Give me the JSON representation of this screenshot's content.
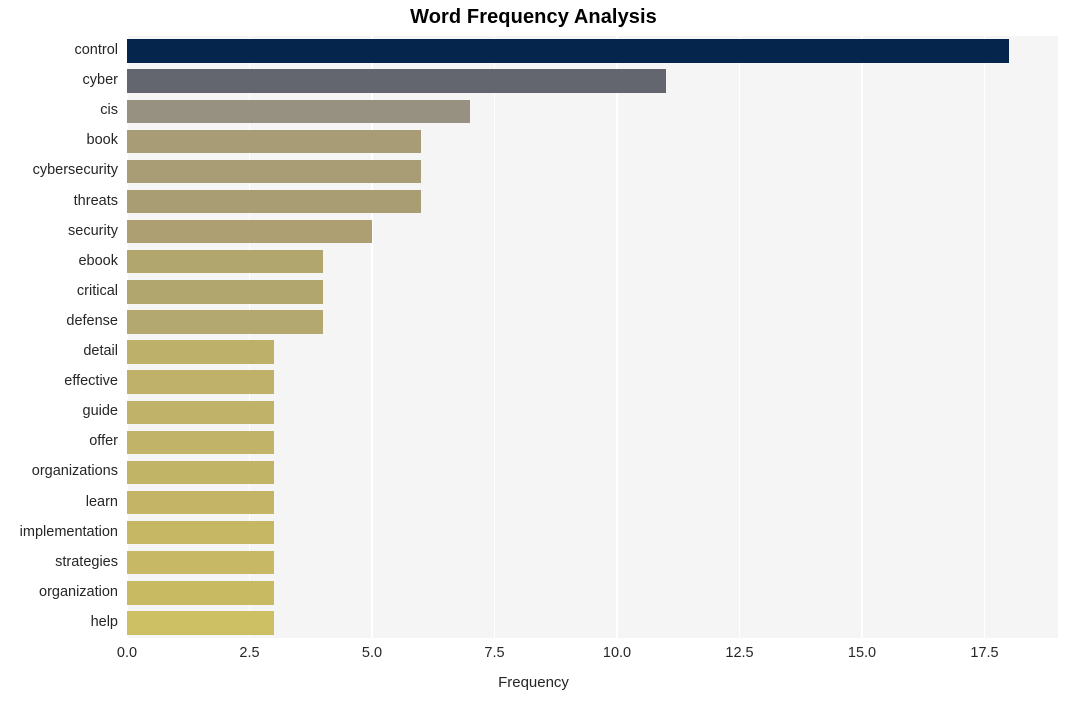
{
  "chart_data": {
    "type": "bar",
    "orientation": "horizontal",
    "title": "Word Frequency Analysis",
    "xlabel": "Frequency",
    "ylabel": "",
    "categories": [
      "control",
      "cyber",
      "cis",
      "book",
      "cybersecurity",
      "threats",
      "security",
      "ebook",
      "critical",
      "defense",
      "detail",
      "effective",
      "guide",
      "offer",
      "organizations",
      "learn",
      "implementation",
      "strategies",
      "organization",
      "help"
    ],
    "values": [
      18,
      11,
      7,
      6,
      6,
      6,
      5,
      4,
      4,
      4,
      3,
      3,
      3,
      3,
      3,
      3,
      3,
      3,
      3,
      3
    ],
    "bar_colors": [
      "#06254d",
      "#63666f",
      "#969180",
      "#a79c76",
      "#a89d74",
      "#a99e73",
      "#ad9f71",
      "#b2a66f",
      "#b2a66f",
      "#b3a870",
      "#bdb06a",
      "#bfb169",
      "#c0b268",
      "#c1b367",
      "#c2b466",
      "#c3b565",
      "#c5b764",
      "#c6b864",
      "#c8ba63",
      "#cdbf63"
    ],
    "xticks": [
      "0.0",
      "2.5",
      "5.0",
      "7.5",
      "10.0",
      "12.5",
      "15.0",
      "17.5"
    ],
    "xtick_values": [
      0,
      2.5,
      5,
      7.5,
      10,
      12.5,
      15,
      17.5
    ],
    "xlim": [
      0,
      19
    ],
    "grid": true,
    "grid_axis": "x",
    "legend": "none",
    "plot_background": "#f5f5f6",
    "grid_color": "#ffffff",
    "figure_background": "#ffffff",
    "text_color": "#262626"
  }
}
